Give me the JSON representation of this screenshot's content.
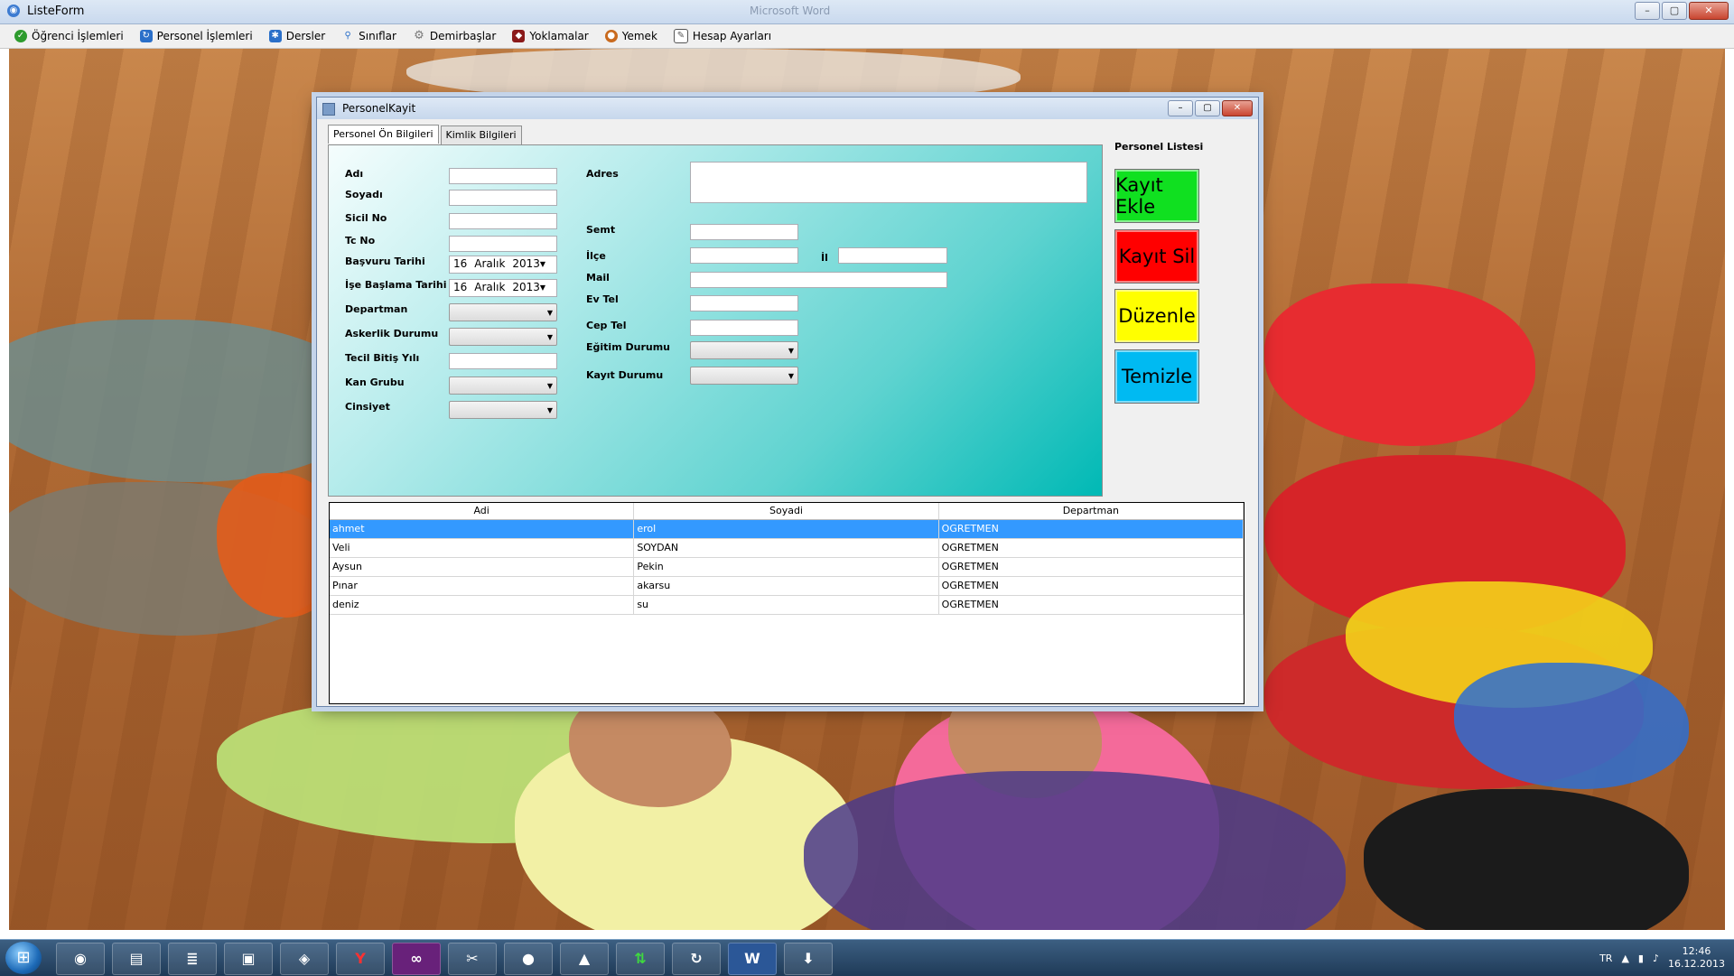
{
  "app": {
    "title": "ListeForm",
    "background_window_title": "Microsoft Word"
  },
  "menu": [
    {
      "label": "Öğrenci İşlemleri",
      "icon": "check-circle-icon",
      "color": "#2e9b2e"
    },
    {
      "label": "Personel İşlemleri",
      "icon": "arrows-icon",
      "color": "#2a6fc9"
    },
    {
      "label": "Dersler",
      "icon": "snowflake-icon",
      "color": "#2a6fc9"
    },
    {
      "label": "Sınıflar",
      "icon": "pin-icon",
      "color": "#2a6fc9"
    },
    {
      "label": "Demirbaşlar",
      "icon": "gear-icon",
      "color": "#7a7a7a"
    },
    {
      "label": "Yoklamalar",
      "icon": "shield-icon",
      "color": "#8b1a1a"
    },
    {
      "label": "Yemek",
      "icon": "food-icon",
      "color": "#c96a1e"
    },
    {
      "label": "Hesap Ayarları",
      "icon": "document-icon",
      "color": "#555555"
    }
  ],
  "dialog": {
    "title": "PersonelKayit",
    "tabs": [
      "Personel Ön Bilgileri",
      "Kimlik Bilgileri"
    ],
    "left_fields": {
      "adi": "Adı",
      "soyadi": "Soyadı",
      "sicil": "Sicil No",
      "tc": "Tc No",
      "basvuru": "Başvuru Tarihi",
      "ise_baslama": "İşe Başlama Tarihi",
      "departman": "Departman",
      "askerlik": "Askerlik Durumu",
      "tecil": "Tecil Bitiş Yılı",
      "kan": "Kan Grubu",
      "cinsiyet": "Cinsiyet"
    },
    "date": {
      "day": "16",
      "month": "Aralık",
      "year": "2013"
    },
    "right_fields": {
      "adres": "Adres",
      "semt": "Semt",
      "ilce": "İlçe",
      "il": "İl",
      "mail": "Mail",
      "evtel": "Ev Tel",
      "ceptel": "Cep Tel",
      "egitim": "Eğitim Durumu",
      "kayit": "Kayıt Durumu"
    },
    "personel_listesi": "Personel Listesi",
    "buttons": {
      "ekle": "Kayıt Ekle",
      "sil": "Kayıt Sil",
      "duzenle": "Düzenle",
      "temizle": "Temizle"
    },
    "button_colors": {
      "ekle": "#10e020",
      "sil": "#ff0000",
      "duzenle": "#ffff00",
      "temizle": "#00baf2"
    },
    "grid": {
      "columns": [
        "Adi",
        "Soyadi",
        "Departman"
      ],
      "rows": [
        [
          "ahmet",
          "erol",
          "OGRETMEN"
        ],
        [
          "Veli",
          "SOYDAN",
          "OGRETMEN"
        ],
        [
          "Aysun",
          "Pekin",
          "OGRETMEN"
        ],
        [
          "Pınar",
          "akarsu",
          "OGRETMEN"
        ],
        [
          "deniz",
          "su",
          "OGRETMEN"
        ]
      ]
    }
  },
  "taskbar": {
    "apps": [
      "chrome-icon",
      "folder-icon",
      "books-icon",
      "media-icon",
      "game-icon",
      "yandex-icon",
      "visual-studio-icon",
      "tools-icon",
      "app-icon",
      "arrow-icon",
      "torrent-icon",
      "refresh-icon",
      "word-icon",
      "download-icon"
    ],
    "yandex": "Y",
    "word": "W",
    "lang": "TR",
    "time": "12:46",
    "date": "16.12.2013"
  }
}
